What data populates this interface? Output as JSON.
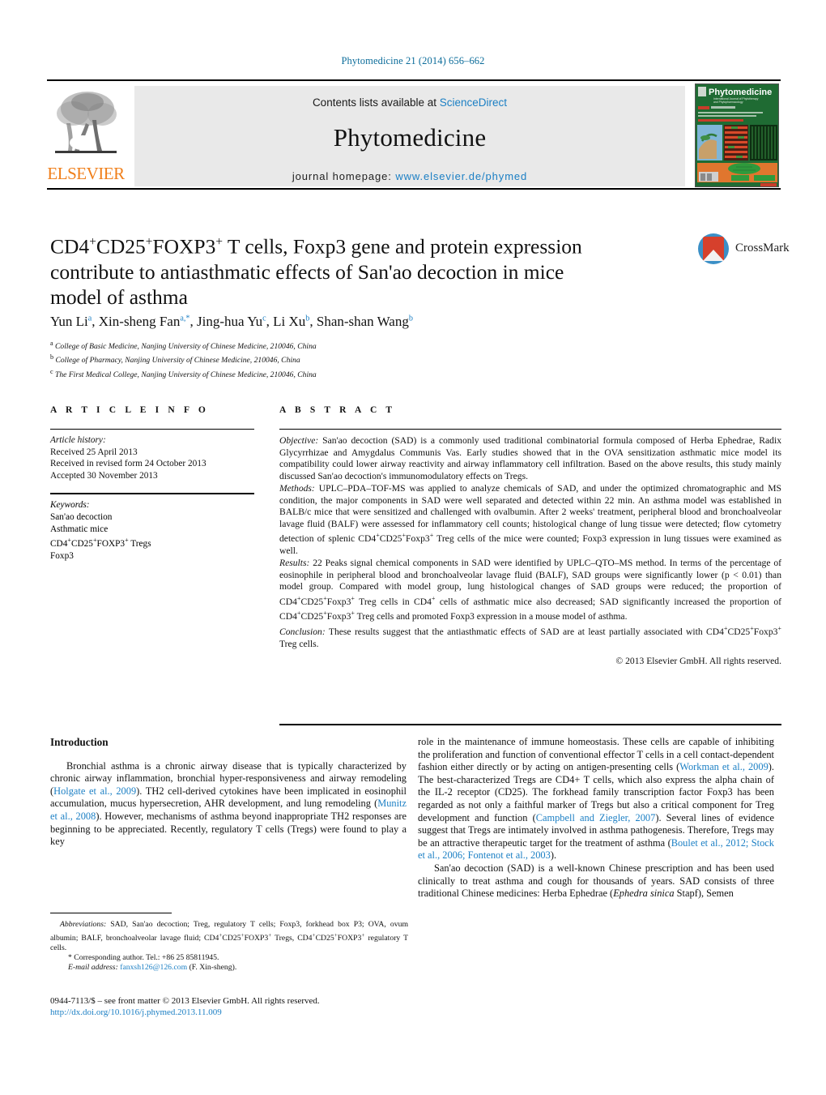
{
  "running_head": "Phytomedicine 21 (2014) 656–662",
  "masthead": {
    "publisher_name": "ELSEVIER",
    "contents_line": "Contents lists available at ",
    "sciencedirect": "ScienceDirect",
    "journal_name": "Phytomedicine",
    "homepage_label": "journal homepage: ",
    "homepage_url": "www.elsevier.de/phymed",
    "cover_title": "Phytomedicine"
  },
  "crossmark": {
    "label": "CrossMark"
  },
  "article": {
    "title_line1_a": "CD4",
    "title_line1_sup1": "+",
    "title_line1_b": "CD25",
    "title_line1_sup2": "+",
    "title_line1_c": "FOXP3",
    "title_line1_sup3": "+",
    "title_line1_d": " T cells, Foxp3 gene and protein expression",
    "title_line2": "contribute to antiasthmatic effects of San'ao decoction",
    "title_line3": "in mice model of asthma",
    "authors": [
      {
        "name": "Yun Li",
        "sup": "a",
        "sep": ", "
      },
      {
        "name": "Xin-sheng Fan",
        "sup": "a,*",
        "sep": ", "
      },
      {
        "name": "Jing-hua Yu",
        "sup": "c",
        "sep": ", "
      },
      {
        "name": "Li Xu",
        "sup": "b",
        "sep": ", "
      },
      {
        "name": "Shan-shan Wang",
        "sup": "b",
        "sep": ""
      }
    ],
    "affiliations": [
      {
        "mark": "a",
        "text": "College of Basic Medicine, Nanjing University of Chinese Medicine, 210046, China"
      },
      {
        "mark": "b",
        "text": "College of Pharmacy, Nanjing University of Chinese Medicine, 210046, China"
      },
      {
        "mark": "c",
        "text": "The First Medical College, Nanjing University of Chinese Medicine, 210046, China"
      }
    ]
  },
  "article_info": {
    "heading": "A R T I C L E   I N F O",
    "history_label": "Article history:",
    "history": [
      "Received 25 April 2013",
      "Received in revised form 24 October 2013",
      "Accepted 30 November 2013"
    ],
    "keywords_label": "Keywords:",
    "keywords": [
      "San'ao decoction",
      "Asthmatic mice",
      "CD4+CD25+FOXP3+ Tregs",
      "Foxp3"
    ]
  },
  "abstract": {
    "heading": "A B S T R A C T",
    "objective_label": "Objective:",
    "objective_text": " San'ao decoction (SAD) is a commonly used traditional combinatorial formula composed of Herba Ephedrae, Radix Glycyrrhizae and Amygdalus Communis Vas. Early studies showed that in the OVA sensitization asthmatic mice model its compatibility could lower airway reactivity and airway inflammatory cell infiltration. Based on the above results, this study mainly discussed San'ao decoction's immunomodulatory effects on Tregs.",
    "methods_label": "Methods:",
    "methods_text": " UPLC–PDA–TOF-MS was applied to analyze chemicals of SAD, and under the optimized chromatographic and MS condition, the major components in SAD were well separated and detected within 22 min. An asthma model was established in BALB/c mice that were sensitized and challenged with ovalbumin. After 2 weeks' treatment, peripheral blood and bronchoalveolar lavage fluid (BALF) were assessed for inflammatory cell counts; histological change of lung tissue were detected; flow cytometry detection of splenic CD4+CD25+Foxp3+ Treg cells of the mice were counted; Foxp3 expression in lung tissues were examined as well.",
    "results_label": "Results:",
    "results_text": " 22 Peaks signal chemical components in SAD were identified by UPLC–QTO–MS method. In terms of the percentage of eosinophile in peripheral blood and bronchoalveolar lavage fluid (BALF), SAD groups were significantly lower (p < 0.01) than model group. Compared with model group, lung histological changes of SAD groups were reduced; the proportion of CD4+CD25+Foxp3+ Treg cells in CD4+ cells of asthmatic mice also decreased; SAD significantly increased the proportion of CD4+CD25+Foxp3+ Treg cells and promoted Foxp3 expression in a mouse model of asthma.",
    "conclusion_label": "Conclusion:",
    "conclusion_text": " These results suggest that the antiasthmatic effects of SAD are at least partially associated with CD4+CD25+Foxp3+ Treg cells.",
    "copyright": "© 2013 Elsevier GmbH. All rights reserved."
  },
  "introduction": {
    "heading": "Introduction",
    "left_p1_a": "Bronchial asthma is a chronic airway disease that is typically characterized by chronic airway inflammation, bronchial hyper-responsiveness and airway remodeling (",
    "left_ref1": "Holgate et al., 2009",
    "left_p1_b": "). TH2 cell-derived cytokines have been implicated in eosinophil accumulation, mucus hypersecretion, AHR development, and lung remodeling (",
    "left_ref2": "Munitz et al., 2008",
    "left_p1_c": "). However, mechanisms of asthma beyond inappropriate TH2 responses are beginning to be appreciated. Recently, regulatory T cells (Tregs) were found to play a key",
    "right_p1_a": "role in the maintenance of immune homeostasis. These cells are capable of inhibiting the proliferation and function of conventional effector T cells in a cell contact-dependent fashion either directly or by acting on antigen-presenting cells (",
    "right_ref1": "Workman et al., 2009",
    "right_p1_b": "). The best-characterized Tregs are CD4+ T cells, which also express the alpha chain of the IL-2 receptor (CD25). The forkhead family transcription factor Foxp3 has been regarded as not only a faithful marker of Tregs but also a critical component for Treg development and function (",
    "right_ref2": "Campbell and Ziegler, 2007",
    "right_p1_c": "). Several lines of evidence suggest that Tregs are intimately involved in asthma pathogenesis. Therefore, Tregs may be an attractive therapeutic target for the treatment of asthma (",
    "right_ref3": "Boulet et al., 2012; Stock et al., 2006; Fontenot et al., 2003",
    "right_p1_d": ").",
    "right_p2_a": "San'ao decoction (SAD) is a well-known Chinese prescription and has been used clinically to treat asthma and cough for thousands of years. SAD consists of three traditional Chinese medicines: Herba Ephedrae (",
    "right_p2_ital": "Ephedra sinica",
    "right_p2_b": " Stapf), Semen"
  },
  "footnotes": {
    "abbrev_label": "Abbreviations:",
    "abbrev_text": "  SAD, San'ao decoction; Treg, regulatory T cells; Foxp3, forkhead box P3; OVA, ovum albumin; BALF, bronchoalveolar lavage fluid; CD4+CD25+FOXP3+ Tregs, CD4+CD25+FOXP3+ regulatory T cells.",
    "corresponding_mark": "*",
    "corresponding_text": " Corresponding author. Tel.: +86 25 85811945.",
    "email_label": "E-mail address:",
    "email": "fanxsh126@126.com",
    "email_suffix": " (F. Xin-sheng).",
    "issn_line": "0944-7113/$ – see front matter © 2013 Elsevier GmbH. All rights reserved.",
    "doi": "http://dx.doi.org/10.1016/j.phymed.2013.11.009"
  }
}
